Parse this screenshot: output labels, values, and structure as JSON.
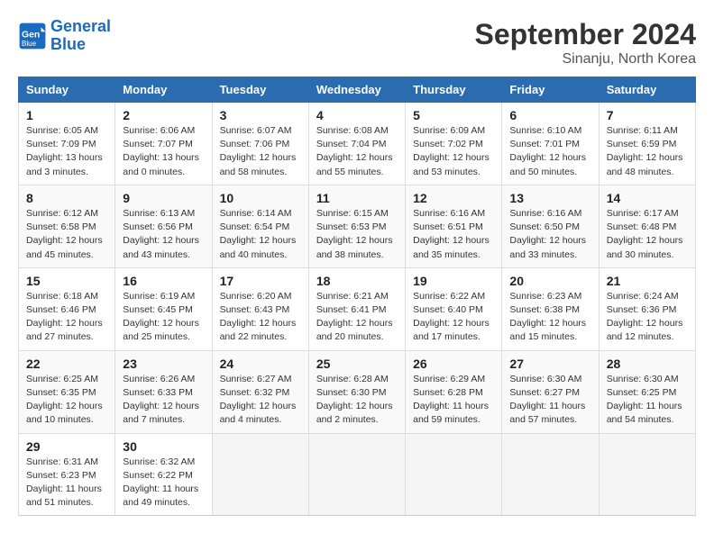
{
  "logo": {
    "line1": "General",
    "line2": "Blue"
  },
  "title": "September 2024",
  "location": "Sinanju, North Korea",
  "days_of_week": [
    "Sunday",
    "Monday",
    "Tuesday",
    "Wednesday",
    "Thursday",
    "Friday",
    "Saturday"
  ],
  "weeks": [
    [
      {
        "day": "1",
        "sunrise": "Sunrise: 6:05 AM",
        "sunset": "Sunset: 7:09 PM",
        "daylight": "Daylight: 13 hours and 3 minutes."
      },
      {
        "day": "2",
        "sunrise": "Sunrise: 6:06 AM",
        "sunset": "Sunset: 7:07 PM",
        "daylight": "Daylight: 13 hours and 0 minutes."
      },
      {
        "day": "3",
        "sunrise": "Sunrise: 6:07 AM",
        "sunset": "Sunset: 7:06 PM",
        "daylight": "Daylight: 12 hours and 58 minutes."
      },
      {
        "day": "4",
        "sunrise": "Sunrise: 6:08 AM",
        "sunset": "Sunset: 7:04 PM",
        "daylight": "Daylight: 12 hours and 55 minutes."
      },
      {
        "day": "5",
        "sunrise": "Sunrise: 6:09 AM",
        "sunset": "Sunset: 7:02 PM",
        "daylight": "Daylight: 12 hours and 53 minutes."
      },
      {
        "day": "6",
        "sunrise": "Sunrise: 6:10 AM",
        "sunset": "Sunset: 7:01 PM",
        "daylight": "Daylight: 12 hours and 50 minutes."
      },
      {
        "day": "7",
        "sunrise": "Sunrise: 6:11 AM",
        "sunset": "Sunset: 6:59 PM",
        "daylight": "Daylight: 12 hours and 48 minutes."
      }
    ],
    [
      {
        "day": "8",
        "sunrise": "Sunrise: 6:12 AM",
        "sunset": "Sunset: 6:58 PM",
        "daylight": "Daylight: 12 hours and 45 minutes."
      },
      {
        "day": "9",
        "sunrise": "Sunrise: 6:13 AM",
        "sunset": "Sunset: 6:56 PM",
        "daylight": "Daylight: 12 hours and 43 minutes."
      },
      {
        "day": "10",
        "sunrise": "Sunrise: 6:14 AM",
        "sunset": "Sunset: 6:54 PM",
        "daylight": "Daylight: 12 hours and 40 minutes."
      },
      {
        "day": "11",
        "sunrise": "Sunrise: 6:15 AM",
        "sunset": "Sunset: 6:53 PM",
        "daylight": "Daylight: 12 hours and 38 minutes."
      },
      {
        "day": "12",
        "sunrise": "Sunrise: 6:16 AM",
        "sunset": "Sunset: 6:51 PM",
        "daylight": "Daylight: 12 hours and 35 minutes."
      },
      {
        "day": "13",
        "sunrise": "Sunrise: 6:16 AM",
        "sunset": "Sunset: 6:50 PM",
        "daylight": "Daylight: 12 hours and 33 minutes."
      },
      {
        "day": "14",
        "sunrise": "Sunrise: 6:17 AM",
        "sunset": "Sunset: 6:48 PM",
        "daylight": "Daylight: 12 hours and 30 minutes."
      }
    ],
    [
      {
        "day": "15",
        "sunrise": "Sunrise: 6:18 AM",
        "sunset": "Sunset: 6:46 PM",
        "daylight": "Daylight: 12 hours and 27 minutes."
      },
      {
        "day": "16",
        "sunrise": "Sunrise: 6:19 AM",
        "sunset": "Sunset: 6:45 PM",
        "daylight": "Daylight: 12 hours and 25 minutes."
      },
      {
        "day": "17",
        "sunrise": "Sunrise: 6:20 AM",
        "sunset": "Sunset: 6:43 PM",
        "daylight": "Daylight: 12 hours and 22 minutes."
      },
      {
        "day": "18",
        "sunrise": "Sunrise: 6:21 AM",
        "sunset": "Sunset: 6:41 PM",
        "daylight": "Daylight: 12 hours and 20 minutes."
      },
      {
        "day": "19",
        "sunrise": "Sunrise: 6:22 AM",
        "sunset": "Sunset: 6:40 PM",
        "daylight": "Daylight: 12 hours and 17 minutes."
      },
      {
        "day": "20",
        "sunrise": "Sunrise: 6:23 AM",
        "sunset": "Sunset: 6:38 PM",
        "daylight": "Daylight: 12 hours and 15 minutes."
      },
      {
        "day": "21",
        "sunrise": "Sunrise: 6:24 AM",
        "sunset": "Sunset: 6:36 PM",
        "daylight": "Daylight: 12 hours and 12 minutes."
      }
    ],
    [
      {
        "day": "22",
        "sunrise": "Sunrise: 6:25 AM",
        "sunset": "Sunset: 6:35 PM",
        "daylight": "Daylight: 12 hours and 10 minutes."
      },
      {
        "day": "23",
        "sunrise": "Sunrise: 6:26 AM",
        "sunset": "Sunset: 6:33 PM",
        "daylight": "Daylight: 12 hours and 7 minutes."
      },
      {
        "day": "24",
        "sunrise": "Sunrise: 6:27 AM",
        "sunset": "Sunset: 6:32 PM",
        "daylight": "Daylight: 12 hours and 4 minutes."
      },
      {
        "day": "25",
        "sunrise": "Sunrise: 6:28 AM",
        "sunset": "Sunset: 6:30 PM",
        "daylight": "Daylight: 12 hours and 2 minutes."
      },
      {
        "day": "26",
        "sunrise": "Sunrise: 6:29 AM",
        "sunset": "Sunset: 6:28 PM",
        "daylight": "Daylight: 11 hours and 59 minutes."
      },
      {
        "day": "27",
        "sunrise": "Sunrise: 6:30 AM",
        "sunset": "Sunset: 6:27 PM",
        "daylight": "Daylight: 11 hours and 57 minutes."
      },
      {
        "day": "28",
        "sunrise": "Sunrise: 6:30 AM",
        "sunset": "Sunset: 6:25 PM",
        "daylight": "Daylight: 11 hours and 54 minutes."
      }
    ],
    [
      {
        "day": "29",
        "sunrise": "Sunrise: 6:31 AM",
        "sunset": "Sunset: 6:23 PM",
        "daylight": "Daylight: 11 hours and 51 minutes."
      },
      {
        "day": "30",
        "sunrise": "Sunrise: 6:32 AM",
        "sunset": "Sunset: 6:22 PM",
        "daylight": "Daylight: 11 hours and 49 minutes."
      },
      null,
      null,
      null,
      null,
      null
    ]
  ]
}
